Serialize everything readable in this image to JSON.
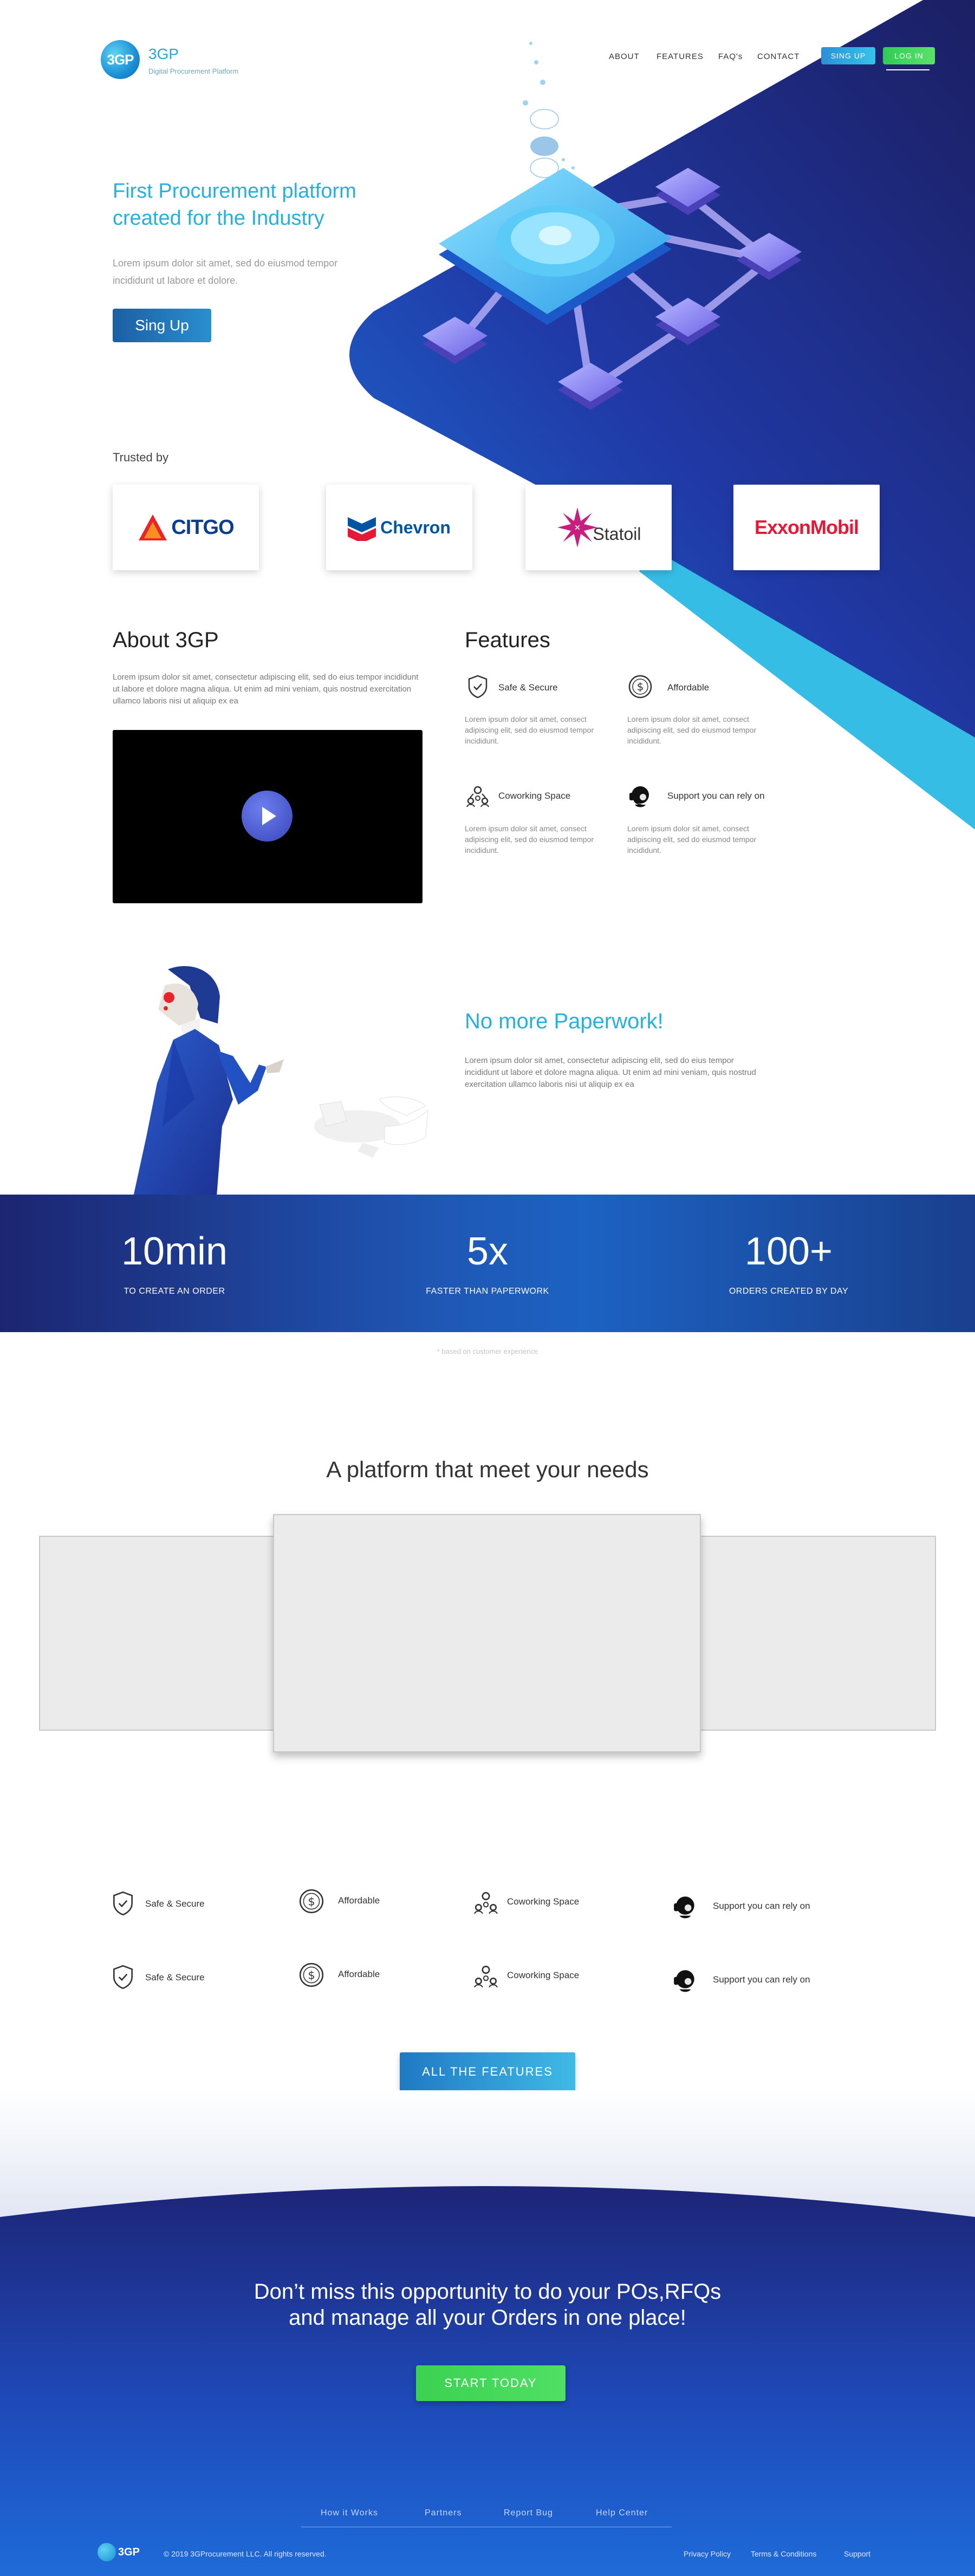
{
  "header": {
    "logo_badge": "3GP",
    "logo_name": "3GP",
    "logo_tagline": "Digital Procurement Platform",
    "nav": [
      "ABOUT",
      "FEATURES",
      "FAQ's",
      "CONTACT"
    ],
    "signup_label": "SING UP",
    "login_label": "LOG IN"
  },
  "hero": {
    "title": "First Procurement platform created for the Industry",
    "subtitle": "Lorem ipsum dolor sit amet, sed do eiusmod tempor incididunt ut labore et dolore.",
    "cta_label": "Sing Up"
  },
  "trusted": {
    "label": "Trusted by",
    "brands": [
      "CITGO",
      "Chevron",
      "Statoil",
      "ExxonMobil"
    ]
  },
  "about": {
    "title": "About 3GP",
    "text": "Lorem ipsum dolor sit amet, consectetur adipiscing elit, sed do eius tempor incididunt ut labore et dolore magna aliqua. Ut enim ad mini veniam, quis nostrud exercitation ullamco laboris nisi ut aliquip ex ea"
  },
  "features": {
    "title": "Features",
    "items": [
      {
        "title": "Safe & Secure",
        "text": "Lorem ipsum dolor sit amet, consect adipiscing elit, sed do eiusmod tempor incididunt.",
        "icon": "shield-check-icon"
      },
      {
        "title": "Affordable",
        "text": "Lorem ipsum dolor sit amet, consect adipiscing elit, sed do eiusmod tempor incididunt.",
        "icon": "dollar-coin-icon"
      },
      {
        "title": "Coworking Space",
        "text": "Lorem ipsum dolor sit amet, consect adipiscing elit, sed do eiusmod tempor incididunt.",
        "icon": "team-icon"
      },
      {
        "title": "Support you can rely on",
        "text": "Lorem ipsum dolor sit amet, consect adipiscing elit, sed do eiusmod tempor incididunt.",
        "icon": "support-headset-icon"
      }
    ]
  },
  "paperwork": {
    "title": "No more Paperwork!",
    "text": "Lorem ipsum dolor sit amet, consectetur adipiscing elit, sed do eius tempor incididunt ut labore et dolore magna aliqua. Ut enim ad mini veniam, quis nostrud exercitation ullamco laboris nisi ut aliquip ex ea"
  },
  "stats": [
    {
      "value": "10min",
      "label": "TO CREATE AN ORDER"
    },
    {
      "value": "5x",
      "label": "FASTER THAN PAPERWORK"
    },
    {
      "value": "100+",
      "label": "ORDERS CREATED BY DAY"
    }
  ],
  "stats_footnote": "* based on customer experience",
  "platform": {
    "title": "A platform that meet your needs"
  },
  "grid": [
    {
      "label": "Safe & Secure",
      "icon": "shield-check-icon"
    },
    {
      "label": "Affordable",
      "icon": "dollar-coin-icon"
    },
    {
      "label": "Coworking Space",
      "icon": "team-icon"
    },
    {
      "label": "Support you can rely on",
      "icon": "support-headset-icon"
    },
    {
      "label": "Safe & Secure",
      "icon": "shield-check-icon"
    },
    {
      "label": "Affordable",
      "icon": "dollar-coin-icon"
    },
    {
      "label": "Coworking Space",
      "icon": "team-icon"
    },
    {
      "label": "Support you can rely on",
      "icon": "support-headset-icon"
    }
  ],
  "all_features_label": "ALL THE FEATURES",
  "cta": {
    "line1": "Don’t miss this opportunity to do your POs,RFQs",
    "line2": "and manage all your Orders in one place!",
    "button": "START TODAY"
  },
  "footer": {
    "links": [
      "How it Works",
      "Partners",
      "Report Bug",
      "Help Center"
    ],
    "logo": "3GP",
    "copyright": "© 2019 3GProcurement LLC. All rights reserved.",
    "legal": [
      "Privacy Policy",
      "Terms & Conditions",
      "Support"
    ]
  },
  "colors": {
    "accent": "#25b0e0",
    "navy": "#1c2571",
    "green": "#3bd151",
    "royal_blue": "#1f57b5"
  }
}
